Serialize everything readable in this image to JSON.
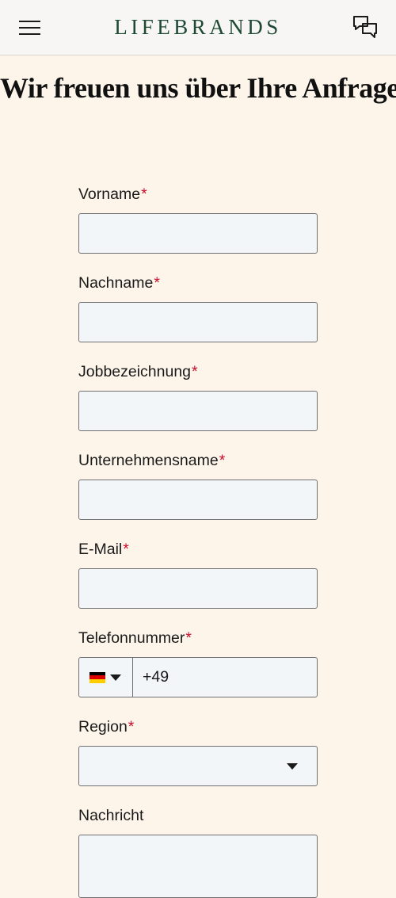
{
  "header": {
    "logo": "LIFEBRANDS",
    "menu_icon": "hamburger-menu-icon",
    "chat_icon": "chat-bubbles-icon",
    "brand_color": "#1e4a33"
  },
  "page": {
    "title": "Wir freuen uns über Ihre Anfrage"
  },
  "form": {
    "required_marker": "*",
    "required_color": "#c8102e",
    "first_name": {
      "label": "Vorname",
      "value": ""
    },
    "last_name": {
      "label": "Nachname",
      "value": ""
    },
    "job_title": {
      "label": "Jobbezeichnung",
      "value": ""
    },
    "company": {
      "label": "Unternehmensname",
      "value": ""
    },
    "email": {
      "label": "E-Mail",
      "value": ""
    },
    "phone": {
      "label": "Telefonnummer",
      "country_flag": "germany-flag-icon",
      "value": "+49"
    },
    "region": {
      "label": "Region",
      "value": ""
    },
    "message": {
      "label": "Nachricht",
      "value": ""
    }
  }
}
